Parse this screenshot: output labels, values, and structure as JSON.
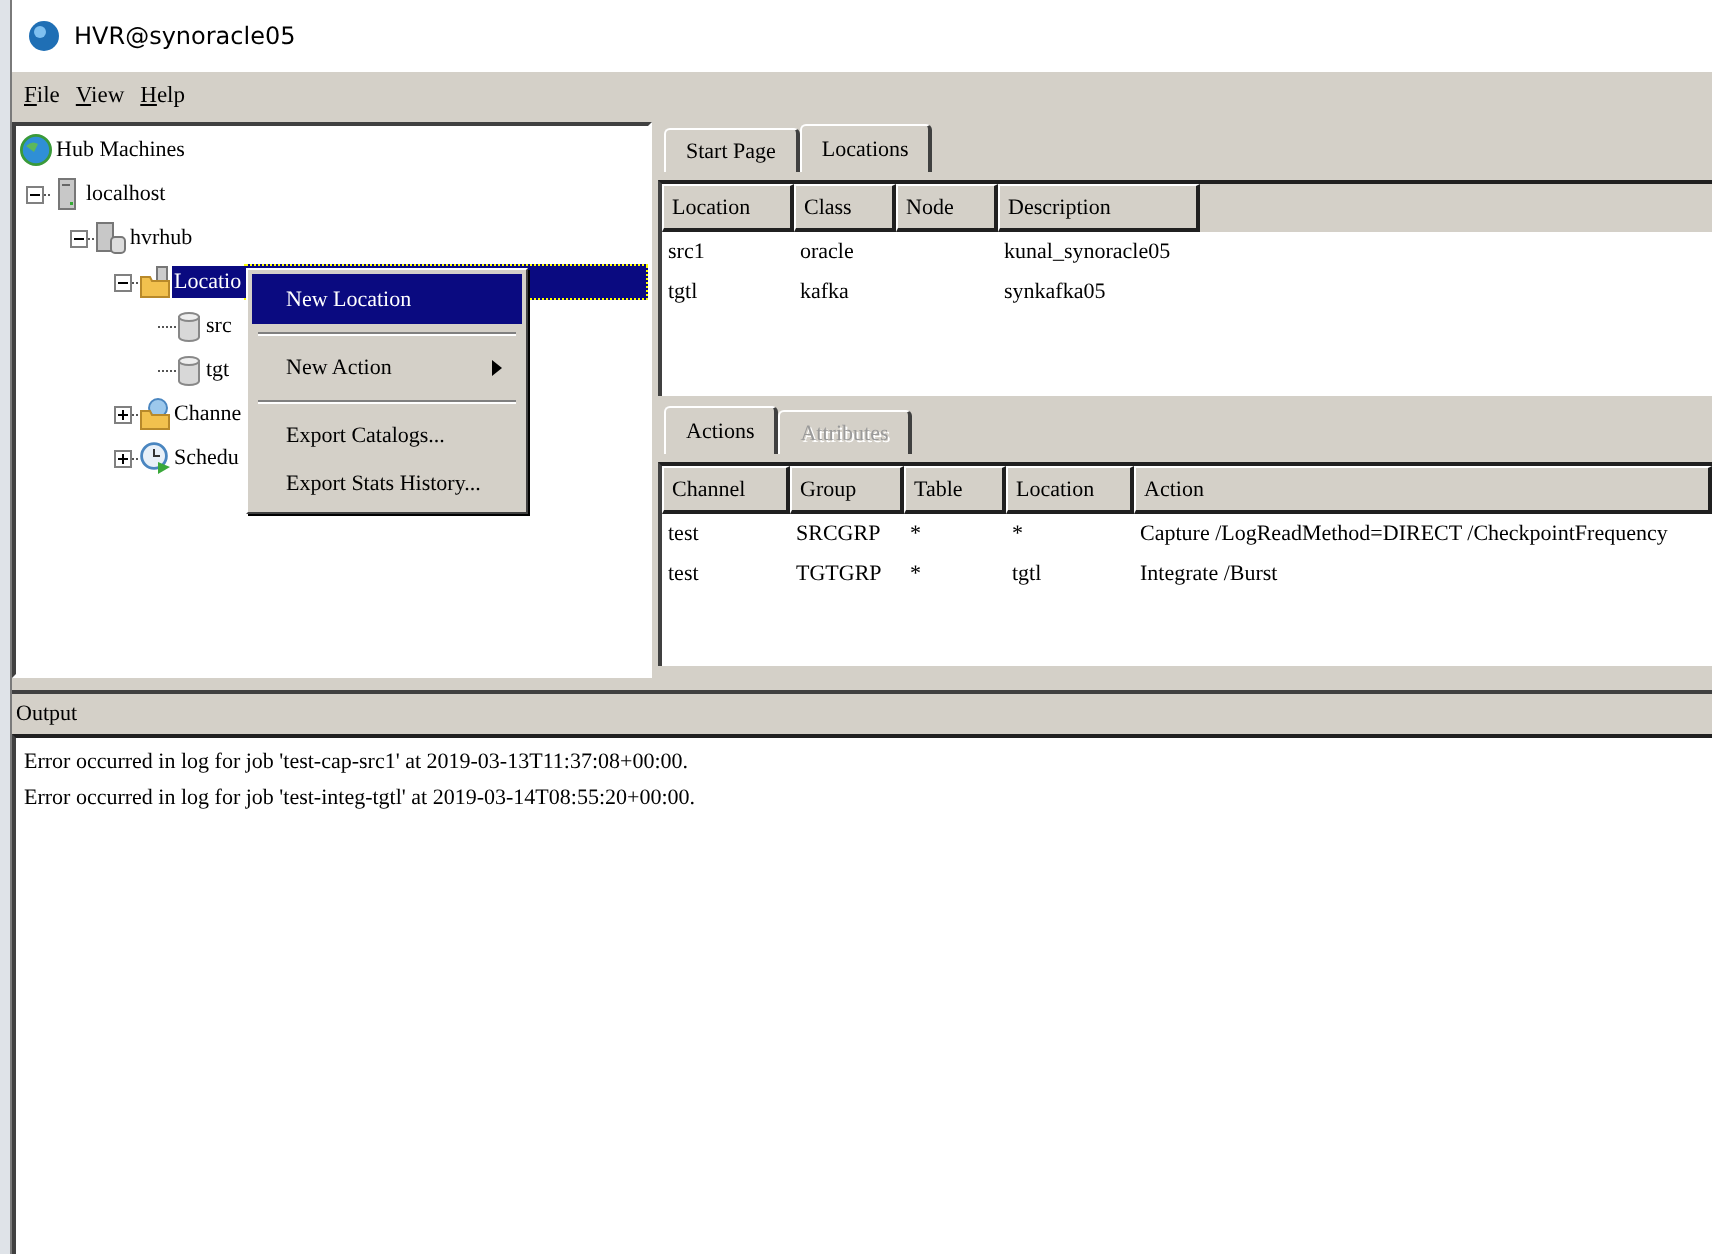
{
  "window": {
    "title": "HVR@synoracle05"
  },
  "menu": [
    "File",
    "View",
    "Help"
  ],
  "tree": {
    "label": "Hub Machines",
    "kind": "globe",
    "selected": false,
    "children": [
      {
        "label": "localhost",
        "kind": "server",
        "selected": false,
        "expanded": true,
        "children": [
          {
            "label": "hvrhub",
            "kind": "hub",
            "selected": false,
            "expanded": true,
            "children": [
              {
                "label": "Locatio",
                "kind": "folder",
                "selected": true,
                "expanded": true,
                "children": [
                  {
                    "label": "src",
                    "kind": "database",
                    "selected": false
                  },
                  {
                    "label": "tgt",
                    "kind": "database",
                    "selected": false
                  }
                ]
              },
              {
                "label": "Channe",
                "kind": "channels",
                "selected": false,
                "expanded": false
              },
              {
                "label": "Schedu",
                "kind": "schedule",
                "selected": false,
                "expanded": false
              }
            ]
          }
        ]
      }
    ]
  },
  "context_menu": [
    {
      "kind": "item",
      "label": "New Location",
      "selected": true,
      "submenu": false
    },
    {
      "kind": "separator"
    },
    {
      "kind": "item",
      "label": "New Action",
      "selected": false,
      "submenu": true
    },
    {
      "kind": "separator"
    },
    {
      "kind": "item",
      "label": "Export Catalogs...",
      "selected": false,
      "submenu": false
    },
    {
      "kind": "item",
      "label": "Export Stats History...",
      "selected": false,
      "submenu": false
    }
  ],
  "top_tabs": [
    {
      "label": "Start Page",
      "selected": false,
      "disabled": false
    },
    {
      "label": "Locations",
      "selected": true,
      "disabled": false
    }
  ],
  "locations_table": {
    "columns": [
      "Location",
      "Class",
      "Node",
      "Description"
    ],
    "rows": [
      [
        "src1",
        "oracle",
        "",
        "kunal_synoracle05"
      ],
      [
        "tgtl",
        "kafka",
        "",
        "synkafka05"
      ]
    ]
  },
  "bottom_tabs": [
    {
      "label": "Actions",
      "selected": true,
      "disabled": false
    },
    {
      "label": "Attributes",
      "selected": false,
      "disabled": true
    }
  ],
  "actions_table": {
    "columns": [
      "Channel",
      "Group",
      "Table",
      "Location",
      "Action"
    ],
    "rows": [
      [
        "test",
        "SRCGRP",
        "*",
        "*",
        "Capture /LogReadMethod=DIRECT /CheckpointFrequency"
      ],
      [
        "test",
        "TGTGRP",
        "*",
        "tgtl",
        "Integrate /Burst"
      ]
    ]
  },
  "output": {
    "title": "Output",
    "lines": [
      "Error occurred in log for job 'test-cap-src1' at 2019-03-13T11:37:08+00:00.",
      "Error occurred in log for job 'test-integ-tgtl' at 2019-03-14T08:55:20+00:00."
    ]
  }
}
